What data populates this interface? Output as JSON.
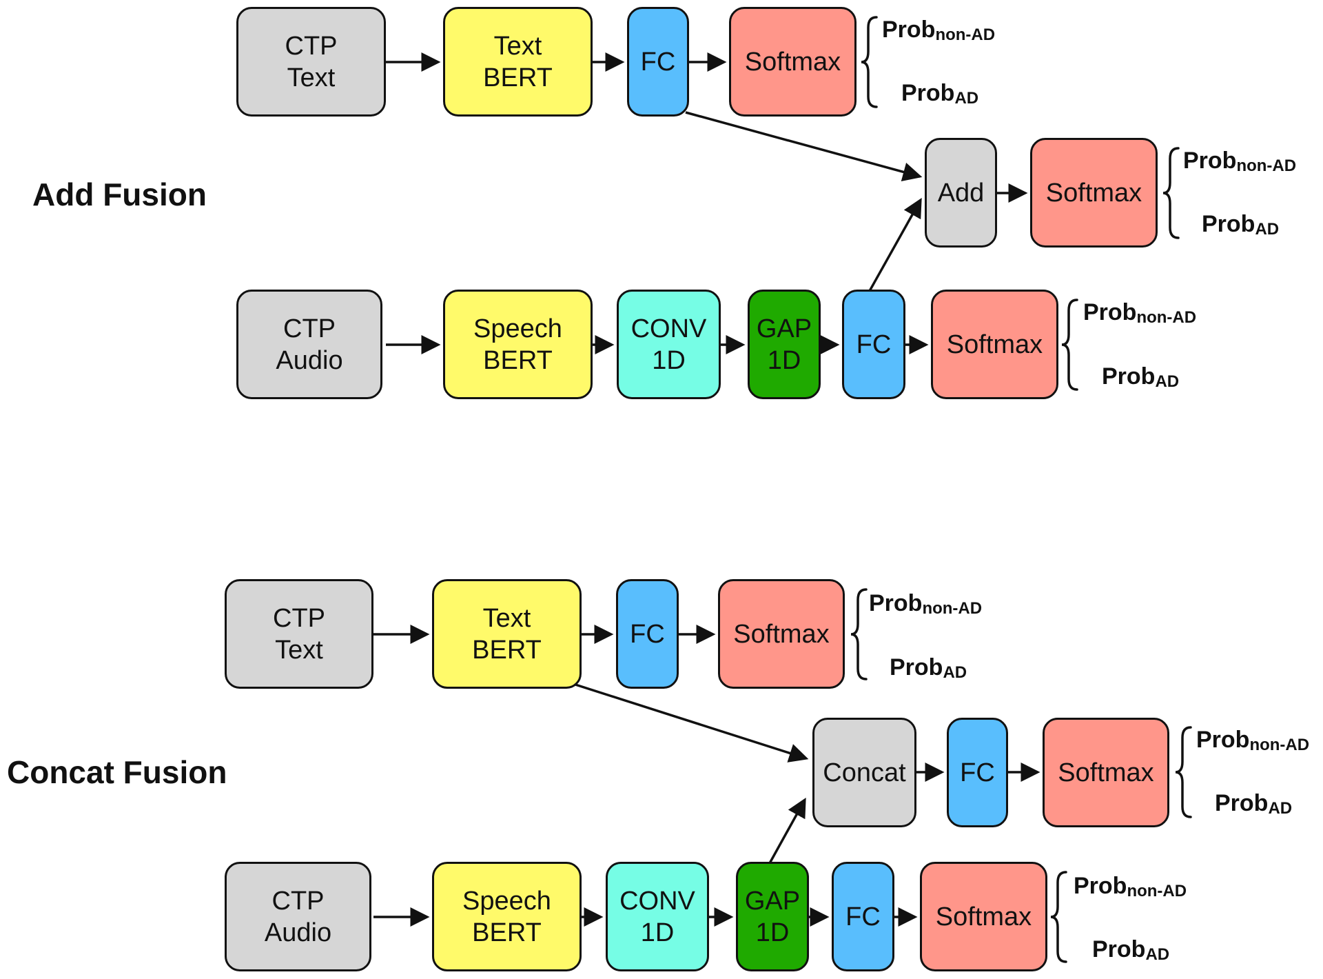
{
  "sections": {
    "add": {
      "title": "Add Fusion",
      "text_row": {
        "ctp": [
          "CTP",
          "Text"
        ],
        "bert": [
          "Text",
          "BERT"
        ],
        "fc": "FC",
        "softmax": "Softmax"
      },
      "fusion": {
        "op": "Add",
        "softmax": "Softmax"
      },
      "audio_row": {
        "ctp": [
          "CTP",
          "Audio"
        ],
        "bert": [
          "Speech",
          "BERT"
        ],
        "conv": [
          "CONV",
          "1D"
        ],
        "gap": [
          "GAP",
          "1D"
        ],
        "fc": "FC",
        "softmax": "Softmax"
      }
    },
    "concat": {
      "title": "Concat Fusion",
      "text_row": {
        "ctp": [
          "CTP",
          "Text"
        ],
        "bert": [
          "Text",
          "BERT"
        ],
        "fc": "FC",
        "softmax": "Softmax"
      },
      "fusion": {
        "op": "Concat",
        "fc": "FC",
        "softmax": "Softmax"
      },
      "audio_row": {
        "ctp": [
          "CTP",
          "Audio"
        ],
        "bert": [
          "Speech",
          "BERT"
        ],
        "conv": [
          "CONV",
          "1D"
        ],
        "gap": [
          "GAP",
          "1D"
        ],
        "fc": "FC",
        "softmax": "Softmax"
      }
    }
  },
  "outputs": {
    "prob_base": "Prob",
    "non_ad_sub": "non-AD",
    "ad_sub": "AD"
  },
  "colors": {
    "input": "#d6d6d6",
    "bert": "#fffa6a",
    "fc": "#59befd",
    "softmax": "#ff968a",
    "conv": "#76fde5",
    "gap": "#1faa00",
    "fusion": "#d6d6d6"
  }
}
